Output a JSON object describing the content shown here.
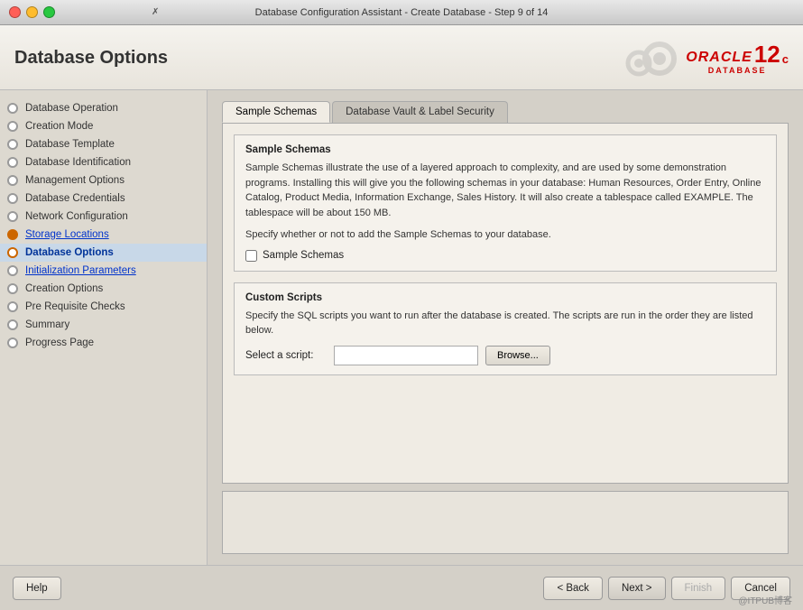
{
  "titleBar": {
    "title": "Database Configuration Assistant - Create Database - Step 9 of 14",
    "icon": "X"
  },
  "header": {
    "title": "Database Options",
    "oracle": {
      "brand": "ORACLE",
      "sub": "DATABASE",
      "version": "12",
      "suffix": "c"
    }
  },
  "sidebar": {
    "items": [
      {
        "id": "database-operation",
        "label": "Database Operation",
        "state": "normal"
      },
      {
        "id": "creation-mode",
        "label": "Creation Mode",
        "state": "normal"
      },
      {
        "id": "database-template",
        "label": "Database Template",
        "state": "normal"
      },
      {
        "id": "database-identification",
        "label": "Database Identification",
        "state": "normal"
      },
      {
        "id": "management-options",
        "label": "Management Options",
        "state": "normal"
      },
      {
        "id": "database-credentials",
        "label": "Database Credentials",
        "state": "normal"
      },
      {
        "id": "network-configuration",
        "label": "Network Configuration",
        "state": "normal"
      },
      {
        "id": "storage-locations",
        "label": "Storage Locations",
        "state": "link"
      },
      {
        "id": "database-options",
        "label": "Database Options",
        "state": "active"
      },
      {
        "id": "initialization-parameters",
        "label": "Initialization Parameters",
        "state": "link"
      },
      {
        "id": "creation-options",
        "label": "Creation Options",
        "state": "normal"
      },
      {
        "id": "pre-requisite-checks",
        "label": "Pre Requisite Checks",
        "state": "normal"
      },
      {
        "id": "summary",
        "label": "Summary",
        "state": "normal"
      },
      {
        "id": "progress-page",
        "label": "Progress Page",
        "state": "normal"
      }
    ]
  },
  "tabs": [
    {
      "id": "sample-schemas",
      "label": "Sample Schemas",
      "active": true
    },
    {
      "id": "database-vault-label-security",
      "label": "Database Vault & Label Security",
      "active": false
    }
  ],
  "sampleSchemas": {
    "sectionTitle": "Sample Schemas",
    "description": "Sample Schemas illustrate the use of a layered approach to complexity, and are used by some demonstration programs. Installing this will give you the following schemas in your database: Human Resources, Order Entry, Online Catalog, Product Media, Information Exchange, Sales History. It will also create a tablespace called EXAMPLE. The tablespace will be about 150 MB.",
    "prompt": "Specify whether or not to add the Sample Schemas to your database.",
    "checkboxLabel": "Sample Schemas",
    "checkboxChecked": false
  },
  "customScripts": {
    "sectionTitle": "Custom Scripts",
    "description": "Specify the SQL scripts you want to run after the database is created. The scripts are run in the order they are listed below.",
    "selectScriptLabel": "Select a script:",
    "scriptInputValue": "",
    "scriptInputPlaceholder": "",
    "browseLabel": "Browse..."
  },
  "footer": {
    "helpLabel": "Help",
    "backLabel": "< Back",
    "nextLabel": "Next >",
    "finishLabel": "Finish",
    "cancelLabel": "Cancel"
  },
  "watermark": "@ITPUB博客"
}
